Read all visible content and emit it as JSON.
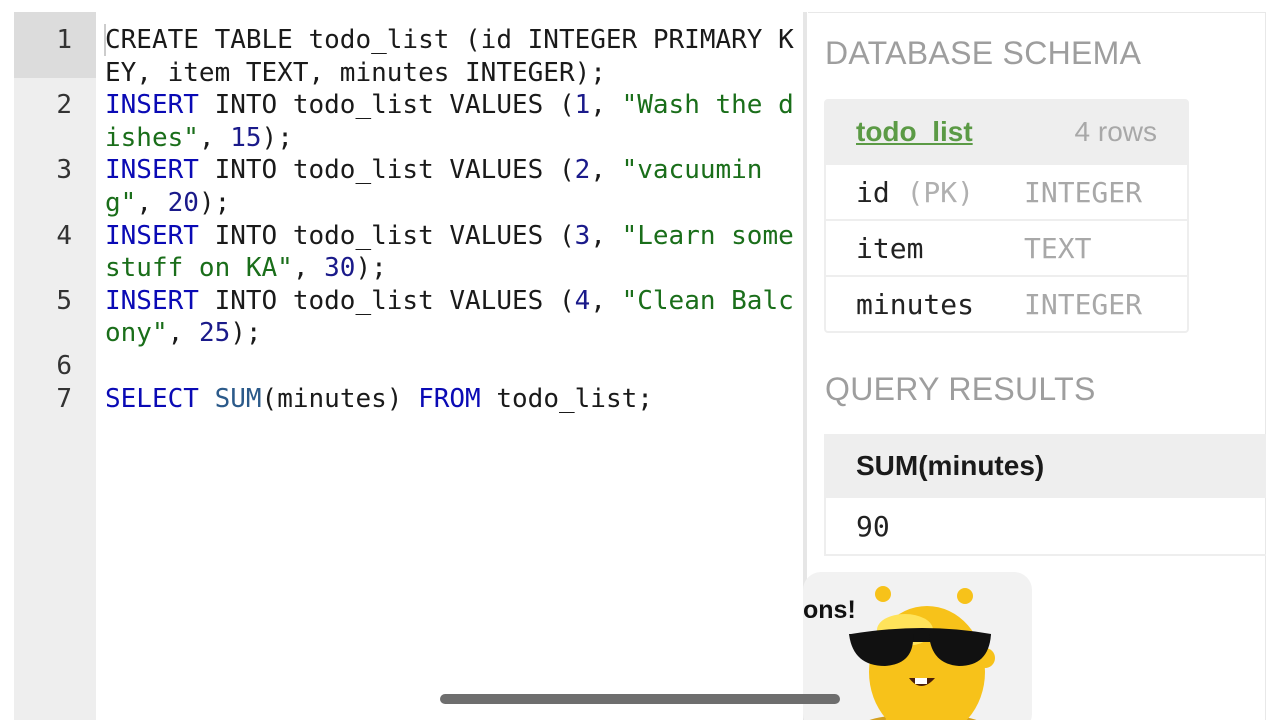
{
  "editor": {
    "lines": [
      {
        "number": "1",
        "tokens": [
          {
            "t": "plain",
            "v": "CREATE TABLE todo_list (id INTEGER PRIMARY KEY, item TEXT, minutes INTEGER);"
          }
        ]
      },
      {
        "number": "2",
        "tokens": [
          {
            "t": "kw",
            "v": "INSERT"
          },
          {
            "t": "plain",
            "v": " INTO todo_list VALUES ("
          },
          {
            "t": "num",
            "v": "1"
          },
          {
            "t": "plain",
            "v": ", "
          },
          {
            "t": "str",
            "v": "\"Wash the dishes\""
          },
          {
            "t": "plain",
            "v": ", "
          },
          {
            "t": "num",
            "v": "15"
          },
          {
            "t": "plain",
            "v": ");"
          }
        ]
      },
      {
        "number": "3",
        "tokens": [
          {
            "t": "kw",
            "v": "INSERT"
          },
          {
            "t": "plain",
            "v": " INTO todo_list VALUES ("
          },
          {
            "t": "num",
            "v": "2"
          },
          {
            "t": "plain",
            "v": ", "
          },
          {
            "t": "str",
            "v": "\"vacuuming\""
          },
          {
            "t": "plain",
            "v": ", "
          },
          {
            "t": "num",
            "v": "20"
          },
          {
            "t": "plain",
            "v": ");"
          }
        ]
      },
      {
        "number": "4",
        "tokens": [
          {
            "t": "kw",
            "v": "INSERT"
          },
          {
            "t": "plain",
            "v": " INTO todo_list VALUES ("
          },
          {
            "t": "num",
            "v": "3"
          },
          {
            "t": "plain",
            "v": ", "
          },
          {
            "t": "str",
            "v": "\"Learn some stuff on KA\""
          },
          {
            "t": "plain",
            "v": ", "
          },
          {
            "t": "num",
            "v": "30"
          },
          {
            "t": "plain",
            "v": ");"
          }
        ]
      },
      {
        "number": "5",
        "tokens": [
          {
            "t": "kw",
            "v": "INSERT"
          },
          {
            "t": "plain",
            "v": " INTO todo_list VALUES ("
          },
          {
            "t": "num",
            "v": "4"
          },
          {
            "t": "plain",
            "v": ", "
          },
          {
            "t": "str",
            "v": "\"Clean Balcony\""
          },
          {
            "t": "plain",
            "v": ", "
          },
          {
            "t": "num",
            "v": "25"
          },
          {
            "t": "plain",
            "v": ");"
          }
        ]
      },
      {
        "number": "6",
        "tokens": []
      },
      {
        "number": "7",
        "tokens": [
          {
            "t": "kw",
            "v": "SELECT"
          },
          {
            "t": "plain",
            "v": " "
          },
          {
            "t": "fn",
            "v": "SUM"
          },
          {
            "t": "plain",
            "v": "(minutes) "
          },
          {
            "t": "kw",
            "v": "FROM"
          },
          {
            "t": "plain",
            "v": " todo_list;"
          }
        ]
      }
    ]
  },
  "schema": {
    "title": "DATABASE SCHEMA",
    "table_name": "todo_list",
    "row_count": "4 rows",
    "columns": [
      {
        "name": "id",
        "pk": "(PK)",
        "type": "INTEGER"
      },
      {
        "name": "item",
        "pk": "",
        "type": "TEXT"
      },
      {
        "name": "minutes",
        "pk": "",
        "type": "INTEGER"
      }
    ]
  },
  "results": {
    "title": "QUERY RESULTS",
    "header": "SUM(minutes)",
    "value": "90"
  },
  "toast": {
    "text": "ons!"
  },
  "colors": {
    "keyword": "#0a0ab5",
    "string": "#1a6e1a",
    "number": "#1a1a8a",
    "table_link": "#5b9a45"
  }
}
